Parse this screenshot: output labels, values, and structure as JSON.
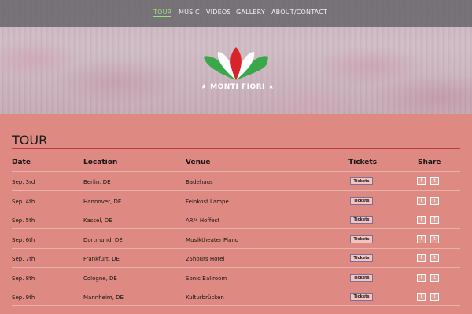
{
  "nav": {
    "items": [
      "TOUR",
      "MUSIC",
      "VIDEOS",
      "GALLERY",
      "ABOUT/CONTACT"
    ],
    "active": "TOUR"
  },
  "logo": {
    "text": "★ MONTI FIORI ★"
  },
  "section": {
    "title": "TOUR"
  },
  "table": {
    "headers": [
      "Date",
      "Location",
      "Venue",
      "Tickets",
      "Share"
    ],
    "rows": [
      {
        "date": "Sep. 3rd",
        "location": "Berlin, DE",
        "venue": "Badehaus",
        "tickets": "Tickets"
      },
      {
        "date": "Sep. 4th",
        "location": "Hannover, DE",
        "venue": "Feinkost Lampe",
        "tickets": "Tickets"
      },
      {
        "date": "Sep. 5th",
        "location": "Kassel, DE",
        "venue": "ARM Hoffest",
        "tickets": "Tickets"
      },
      {
        "date": "Sep. 6th",
        "location": "Dortmund, DE",
        "venue": "Musiktheater Piano",
        "tickets": "Tickets"
      },
      {
        "date": "Sep. 7th",
        "location": "Frankfurt, DE",
        "venue": "25hours Hotel",
        "tickets": "Tickets"
      },
      {
        "date": "Sep. 8th",
        "location": "Cologne, DE",
        "venue": "Sonic Ballroom",
        "tickets": "Tickets"
      },
      {
        "date": "Sep. 9th",
        "location": "Mannheim, DE",
        "venue": "Kulturbrücken",
        "tickets": "Tickets"
      }
    ],
    "share_icons": {
      "facebook": "f",
      "twitter": "t"
    }
  },
  "colors": {
    "background": "#de8a82",
    "accent_red": "#c0393a",
    "nav_active": "#9be07a",
    "logo_green": "#3aa84a",
    "logo_red": "#d8232a"
  }
}
